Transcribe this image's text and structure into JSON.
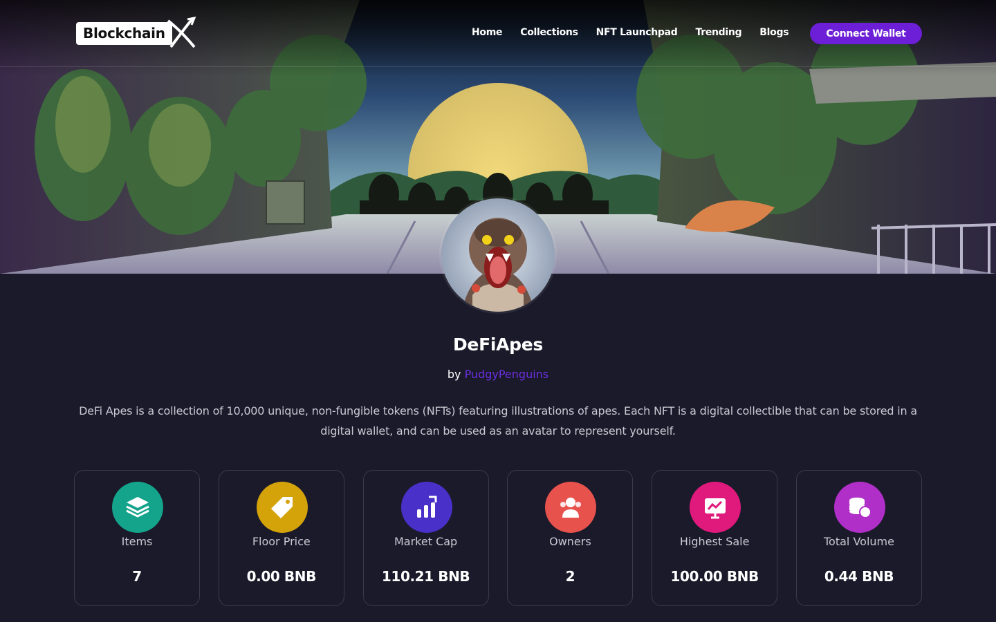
{
  "header": {
    "logo_text": "Blockchain",
    "nav": [
      "Home",
      "Collections",
      "NFT Launchpad",
      "Trending",
      "Blogs"
    ],
    "connect_label": "Connect Wallet"
  },
  "collection": {
    "name": "DeFiApes",
    "by_prefix": "by",
    "creator": "PudgyPenguins",
    "description": "DeFi Apes is a collection of 10,000 unique, non-fungible tokens (NFTs) featuring illustrations of apes. Each NFT is a digital collectible that can be stored in a digital wallet, and can be used as an avatar to represent yourself."
  },
  "stats": [
    {
      "label": "Items",
      "value": "7",
      "icon": "layers-icon",
      "color": "#14a38b"
    },
    {
      "label": "Floor Price",
      "value": "0.00 BNB",
      "icon": "tag-icon",
      "color": "#d4a30a"
    },
    {
      "label": "Market Cap",
      "value": "110.21 BNB",
      "icon": "chart-up-icon",
      "color": "#4930c9"
    },
    {
      "label": "Owners",
      "value": "2",
      "icon": "users-icon",
      "color": "#e8524d"
    },
    {
      "label": "Highest Sale",
      "value": "100.00 BNB",
      "icon": "presentation-chart-icon",
      "color": "#e0197c"
    },
    {
      "label": "Total Volume",
      "value": "0.44 BNB",
      "icon": "coins-icon",
      "color": "#b02fc8"
    }
  ],
  "colors": {
    "accent": "#6c1fd6",
    "background": "#1b1a2a",
    "creator_link": "#6c2fe0"
  }
}
